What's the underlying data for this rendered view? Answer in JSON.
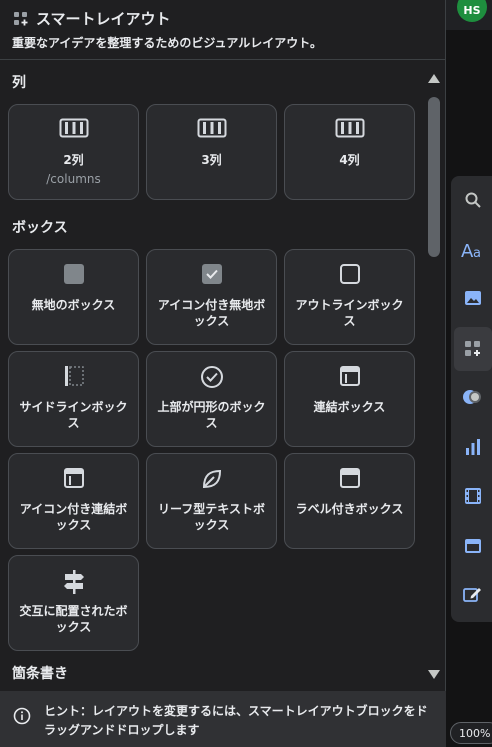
{
  "header": {
    "icon": "smart-layout-icon",
    "title": "スマートレイアウト",
    "subtitle": "重要なアイデアを整理するためのビジュアルレイアウト。"
  },
  "sections": {
    "columns": {
      "title": "列",
      "cards": [
        {
          "label": "2列",
          "sub": "/columns",
          "icon": "columns-icon"
        },
        {
          "label": "3列",
          "icon": "columns-icon"
        },
        {
          "label": "4列",
          "icon": "columns-icon"
        }
      ]
    },
    "boxes": {
      "title": "ボックス",
      "cards": [
        {
          "label": "無地のボックス",
          "icon": "solid-box-icon"
        },
        {
          "label": "アイコン付き無地ボックス",
          "icon": "checkbox-icon"
        },
        {
          "label": "アウトラインボックス",
          "icon": "outline-box-icon"
        },
        {
          "label": "サイドラインボックス",
          "icon": "sideline-box-icon"
        },
        {
          "label": "上部が円形のボックス",
          "icon": "check-circle-icon"
        },
        {
          "label": "連結ボックス",
          "icon": "joined-box-icon"
        },
        {
          "label": "アイコン付き連結ボックス",
          "icon": "joined-box-icon"
        },
        {
          "label": "リーフ型テキストボックス",
          "icon": "leaf-icon"
        },
        {
          "label": "ラベル付きボックス",
          "icon": "label-box-icon"
        },
        {
          "label": "交互に配置されたボックス",
          "icon": "signpost-icon"
        }
      ]
    },
    "bullets": {
      "title": "箇条書き"
    }
  },
  "hint": {
    "icon": "info-icon",
    "text": "ヒント：レイアウトを変更するには、スマートレイアウトブロックをドラッグアンドドロップします"
  },
  "right_toolbar": {
    "avatar_initials": "HS",
    "zoom": "100%",
    "tools": [
      "search-icon",
      "text-icon",
      "image-icon",
      "smart-layout-icon",
      "toggle-icon",
      "chart-icon",
      "film-icon",
      "card-icon",
      "edit-icon"
    ],
    "active_tool": "smart-layout-icon"
  },
  "colors": {
    "panel_bg": "#1f1f21",
    "card_bg": "#2a2b2e",
    "card_border": "#4a4d52",
    "icon": "#d5d9de",
    "accent_blue": "#8ab4f8",
    "avatar": "#1e8e3e"
  }
}
